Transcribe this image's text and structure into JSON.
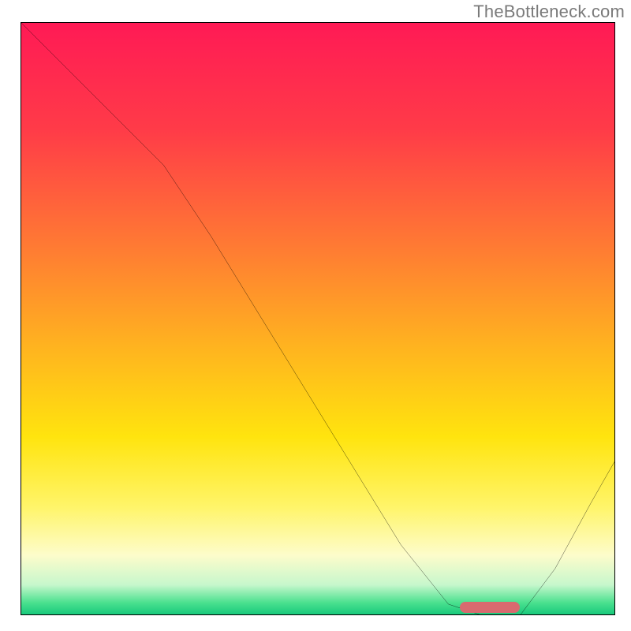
{
  "watermark": "TheBottleneck.com",
  "colors": {
    "border": "#000000",
    "curve": "#000000",
    "marker": "#d96a6f",
    "gradient_stops": [
      {
        "pct": 0,
        "color": "#ff1a55"
      },
      {
        "pct": 18,
        "color": "#ff3b48"
      },
      {
        "pct": 38,
        "color": "#ff7b33"
      },
      {
        "pct": 55,
        "color": "#ffb41f"
      },
      {
        "pct": 70,
        "color": "#ffe40e"
      },
      {
        "pct": 82,
        "color": "#fff56b"
      },
      {
        "pct": 90,
        "color": "#fdfccb"
      },
      {
        "pct": 95,
        "color": "#c7f7cc"
      },
      {
        "pct": 98,
        "color": "#4be18f"
      },
      {
        "pct": 100,
        "color": "#18c97b"
      }
    ]
  },
  "chart_data": {
    "type": "line",
    "title": "",
    "xlabel": "",
    "ylabel": "",
    "xlim": [
      0,
      100
    ],
    "ylim": [
      0,
      100
    ],
    "grid": false,
    "legend": "none",
    "series": [
      {
        "name": "bottleneck-curve",
        "x": [
          0,
          8,
          16,
          24,
          32,
          40,
          48,
          56,
          64,
          72,
          78,
          84,
          90,
          96,
          100
        ],
        "y": [
          100,
          92,
          84,
          76,
          64,
          51,
          38,
          25,
          12,
          2,
          0,
          0,
          8,
          19,
          26
        ]
      }
    ],
    "annotations": [
      {
        "name": "optimal-range-marker",
        "x_start": 74,
        "x_end": 84,
        "y": 1.2
      }
    ]
  }
}
